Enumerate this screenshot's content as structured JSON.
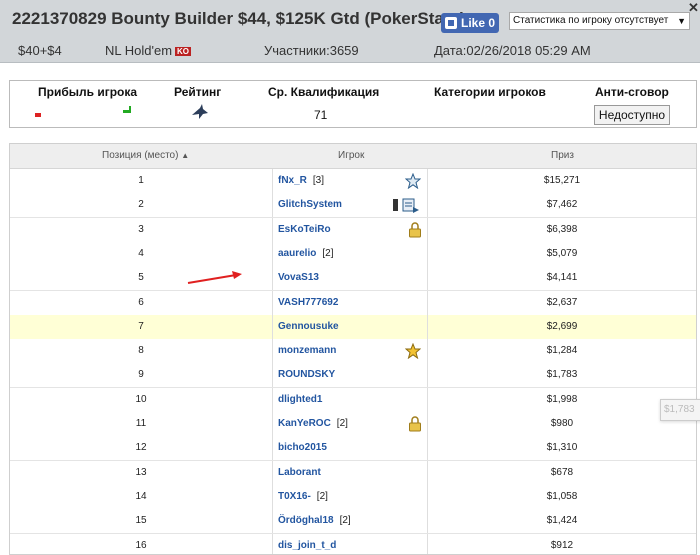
{
  "header": {
    "title": "2221370829 Bounty Builder $44, $125K Gtd (PokerStars)",
    "like_label": "Like 0",
    "stats_select": "Статистика по игроку отсутствует",
    "buyin": "$40+$4",
    "game": "NL Hold'em",
    "game_badge": "KO",
    "participants": "Участники:3659",
    "date": "Дата:02/26/2018 05:29 AM"
  },
  "summary": {
    "headers": [
      "Прибыль игрока",
      "Рейтинг",
      "Ср. Квалификация",
      "Категории игроков",
      "Анти-сговор"
    ],
    "avg_qualification": "71",
    "anti_collusion_button": "Недоступно"
  },
  "table": {
    "columns": [
      "Позиция (место)",
      "Игрок",
      "Приз"
    ],
    "sort_indicator": "▲",
    "rows": [
      {
        "pos": "1",
        "player": "fNx_R",
        "note": "[3]",
        "prize": "$15,271",
        "icon": "star-outline-icon"
      },
      {
        "pos": "2",
        "player": "GlitchSystem",
        "note": "",
        "prize": "$7,462",
        "icon": "device-report-icon"
      },
      {
        "pos": "3",
        "player": "EsKoTeiRo",
        "note": "",
        "prize": "$6,398",
        "icon": "lock-icon"
      },
      {
        "pos": "4",
        "player": "aaurelio",
        "note": "[2]",
        "prize": "$5,079",
        "icon": ""
      },
      {
        "pos": "5",
        "player": "VovaS13",
        "note": "",
        "prize": "$4,141",
        "icon": ""
      },
      {
        "pos": "6",
        "player": "VASH777692",
        "note": "",
        "prize": "$2,637",
        "icon": ""
      },
      {
        "pos": "7",
        "player": "Gennousuke",
        "note": "",
        "prize": "$2,699",
        "icon": ""
      },
      {
        "pos": "8",
        "player": "monzemann",
        "note": "",
        "prize": "$1,284",
        "icon": "star-gold-icon"
      },
      {
        "pos": "9",
        "player": "ROUNDSKY",
        "note": "",
        "prize": "$1,783",
        "icon": ""
      },
      {
        "pos": "10",
        "player": "dlighted1",
        "note": "",
        "prize": "$1,998",
        "icon": ""
      },
      {
        "pos": "11",
        "player": "KanYeROC",
        "note": "[2]",
        "prize": "$980",
        "icon": "lock-icon"
      },
      {
        "pos": "12",
        "player": "bicho2015",
        "note": "",
        "prize": "$1,310",
        "icon": ""
      },
      {
        "pos": "13",
        "player": "Laborant",
        "note": "",
        "prize": "$678",
        "icon": ""
      },
      {
        "pos": "14",
        "player": "T0X16-",
        "note": "[2]",
        "prize": "$1,058",
        "icon": ""
      },
      {
        "pos": "15",
        "player": "Ördöghal18",
        "note": "[2]",
        "prize": "$1,424",
        "icon": ""
      },
      {
        "pos": "16",
        "player": "dis_join_t_d",
        "note": "",
        "prize": "$912",
        "icon": ""
      }
    ]
  },
  "tooltip": "$1,783",
  "colors": {
    "header_bg": "#d2d6d9",
    "link": "#2255a0",
    "highlight_row": "#ffffd6",
    "facebook": "#4267b2",
    "arrow": "#e02020"
  }
}
